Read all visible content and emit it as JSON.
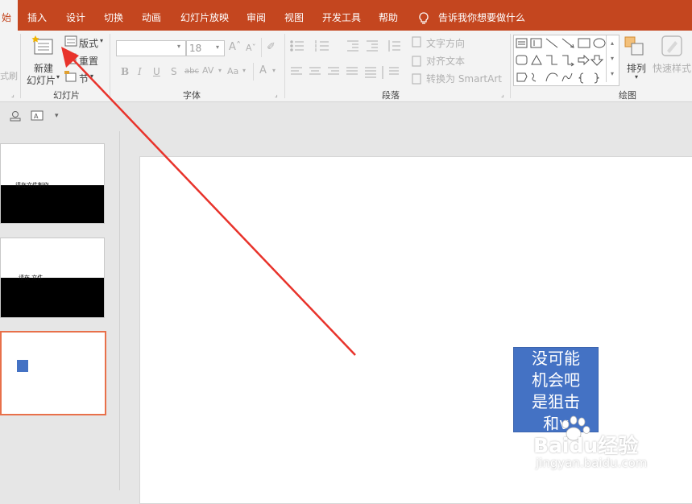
{
  "tabs": [
    "始",
    "插入",
    "设计",
    "切换",
    "动画",
    "幻灯片放映",
    "审阅",
    "视图",
    "开发工具",
    "帮助"
  ],
  "tell_me": "告诉我你想要做什么",
  "ribbon": {
    "slides_group": {
      "new_slide_line1": "新建",
      "new_slide_line2": "幻灯片",
      "layout": "版式",
      "reset": "重置",
      "section": "节",
      "label": "幻灯片",
      "left_cut": "式刷"
    },
    "font_group": {
      "font_size": "18",
      "label": "字体"
    },
    "paragraph_group": {
      "text_direction": "文字方向",
      "align_text": "对齐文本",
      "convert_smartart": "转换为 SmartArt",
      "label": "段落"
    },
    "drawing_group": {
      "arrange": "排列",
      "quick_styles": "快速样式",
      "label": "绘图"
    }
  },
  "thumbnails": [
    {
      "caption": "请在文件制作"
    },
    {
      "caption": "请在 文件"
    },
    {
      "caption": ""
    }
  ],
  "textbox": {
    "lines": [
      "没可能",
      "机会吧",
      "是狙击",
      "和v"
    ]
  },
  "watermark": {
    "brand": "Baidu经验",
    "url": "jingyan.baidu.com"
  },
  "colors": {
    "accent": "#c4461f",
    "textbox": "#4472c4",
    "arrow": "#e8332b",
    "selected_thumb": "#e8704a"
  }
}
